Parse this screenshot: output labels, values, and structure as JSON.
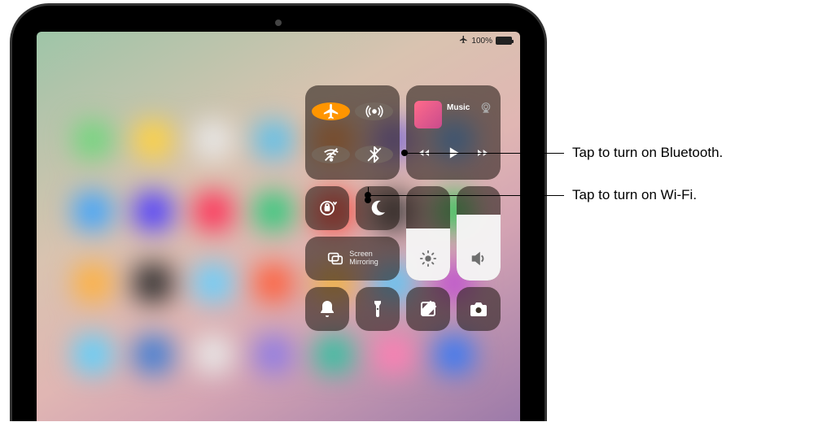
{
  "status": {
    "battery": "100%"
  },
  "control_center": {
    "connectivity": {
      "airplane": {
        "name": "airplane-mode",
        "active": true
      },
      "airdrop": {
        "name": "airdrop",
        "active": false
      },
      "wifi": {
        "name": "wifi",
        "active": false
      },
      "bluetooth": {
        "name": "bluetooth",
        "active": false
      }
    },
    "media": {
      "title": "Music"
    },
    "screen_mirroring": {
      "label": "Screen\nMirroring"
    },
    "brightness": {
      "fill": 0.55
    },
    "volume": {
      "fill": 0.7
    }
  },
  "callouts": {
    "bluetooth": "Tap to turn on Bluetooth.",
    "wifi": "Tap to turn on Wi-Fi."
  },
  "blur_apps": [
    "#6fd67c",
    "#ffd23f",
    "#e8e8e8",
    "#5bc0eb",
    "#f08c3a",
    "#7d6bd4",
    "#4aa6ff",
    "#3aa3ff",
    "#4a3aff",
    "#ff2d55",
    "#2cc97a",
    "#ff3b30",
    "#3e3e3e",
    "#34c759",
    "#ffb13d",
    "#2a2a2a",
    "#65d0ff",
    "#ff5e3a",
    "#f0b33c",
    "#5ac8fa",
    "#bf4fd0",
    "#5ad1ff",
    "#3a7bd5",
    "#e8e8e8",
    "#8c7ae6",
    "#2fc1a0",
    "#ff7eb3",
    "#3478f6"
  ]
}
